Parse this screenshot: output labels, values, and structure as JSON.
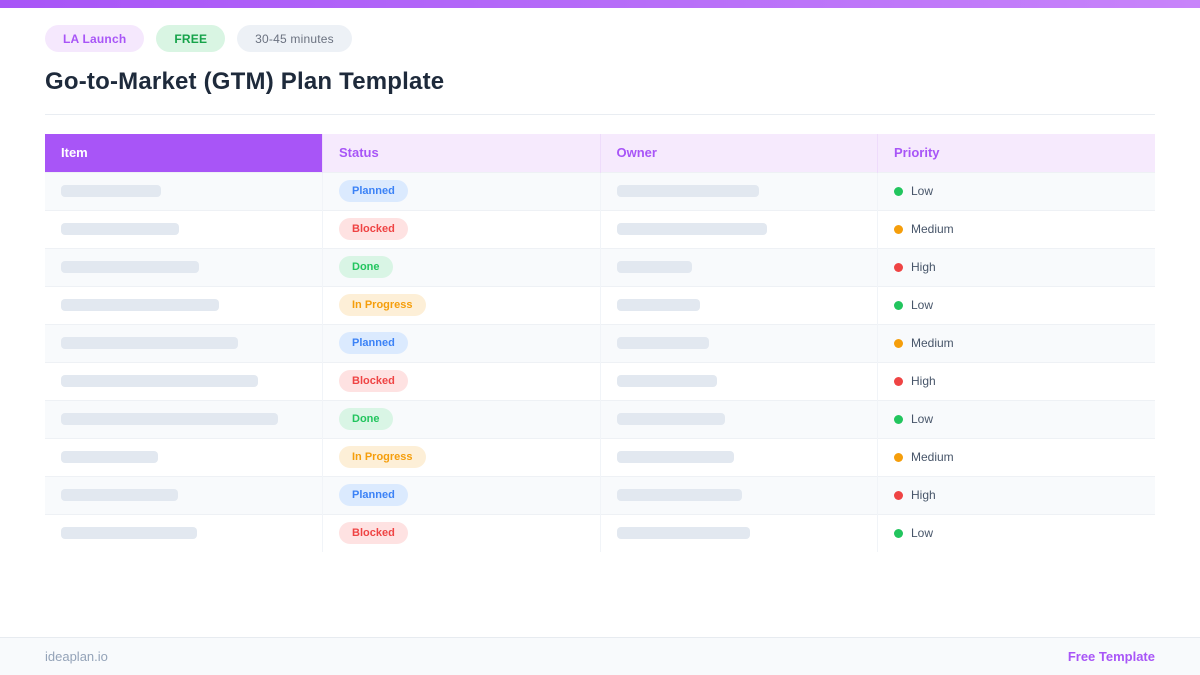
{
  "header": {
    "badges": [
      {
        "label": "LA Launch",
        "style": "brand"
      },
      {
        "label": "FREE",
        "style": "free"
      },
      {
        "label": "30-45 minutes",
        "style": "time"
      }
    ],
    "title": "Go-to-Market (GTM) Plan Template"
  },
  "table": {
    "columns": [
      "Item",
      "Status",
      "Owner",
      "Priority"
    ],
    "rows": [
      {
        "item_bar_width": 100,
        "status": "Planned",
        "owner_bar_width": 142,
        "priority": "Low"
      },
      {
        "item_bar_width": 118,
        "status": "Blocked",
        "owner_bar_width": 150,
        "priority": "Medium"
      },
      {
        "item_bar_width": 138,
        "status": "Done",
        "owner_bar_width": 75,
        "priority": "High"
      },
      {
        "item_bar_width": 158,
        "status": "In Progress",
        "owner_bar_width": 83,
        "priority": "Low"
      },
      {
        "item_bar_width": 177,
        "status": "Planned",
        "owner_bar_width": 92,
        "priority": "Medium"
      },
      {
        "item_bar_width": 197,
        "status": "Blocked",
        "owner_bar_width": 100,
        "priority": "High"
      },
      {
        "item_bar_width": 217,
        "status": "Done",
        "owner_bar_width": 108,
        "priority": "Low"
      },
      {
        "item_bar_width": 97,
        "status": "In Progress",
        "owner_bar_width": 117,
        "priority": "Medium"
      },
      {
        "item_bar_width": 117,
        "status": "Planned",
        "owner_bar_width": 125,
        "priority": "High"
      },
      {
        "item_bar_width": 136,
        "status": "Blocked",
        "owner_bar_width": 133,
        "priority": "Low"
      }
    ],
    "status_styles": {
      "Planned": {
        "bg": "#dbeafe",
        "fg": "#3b82f6"
      },
      "Blocked": {
        "bg": "#fee2e2",
        "fg": "#ef4444"
      },
      "Done": {
        "bg": "#d9f5e5",
        "fg": "#22c55e"
      },
      "In Progress": {
        "bg": "#fdefd7",
        "fg": "#f59e0b"
      }
    },
    "priority_colors": {
      "Low": "#22c55e",
      "Medium": "#f59e0b",
      "High": "#ef4444"
    }
  },
  "footer": {
    "left": "ideaplan.io",
    "right": "Free Template"
  },
  "colors": {
    "accent": "#a855f7",
    "header_cell_bg": "#f6eafd",
    "skeleton": "#e2e8f0",
    "row_alt": "#f8fafc",
    "title_text": "#1e2a3b"
  }
}
